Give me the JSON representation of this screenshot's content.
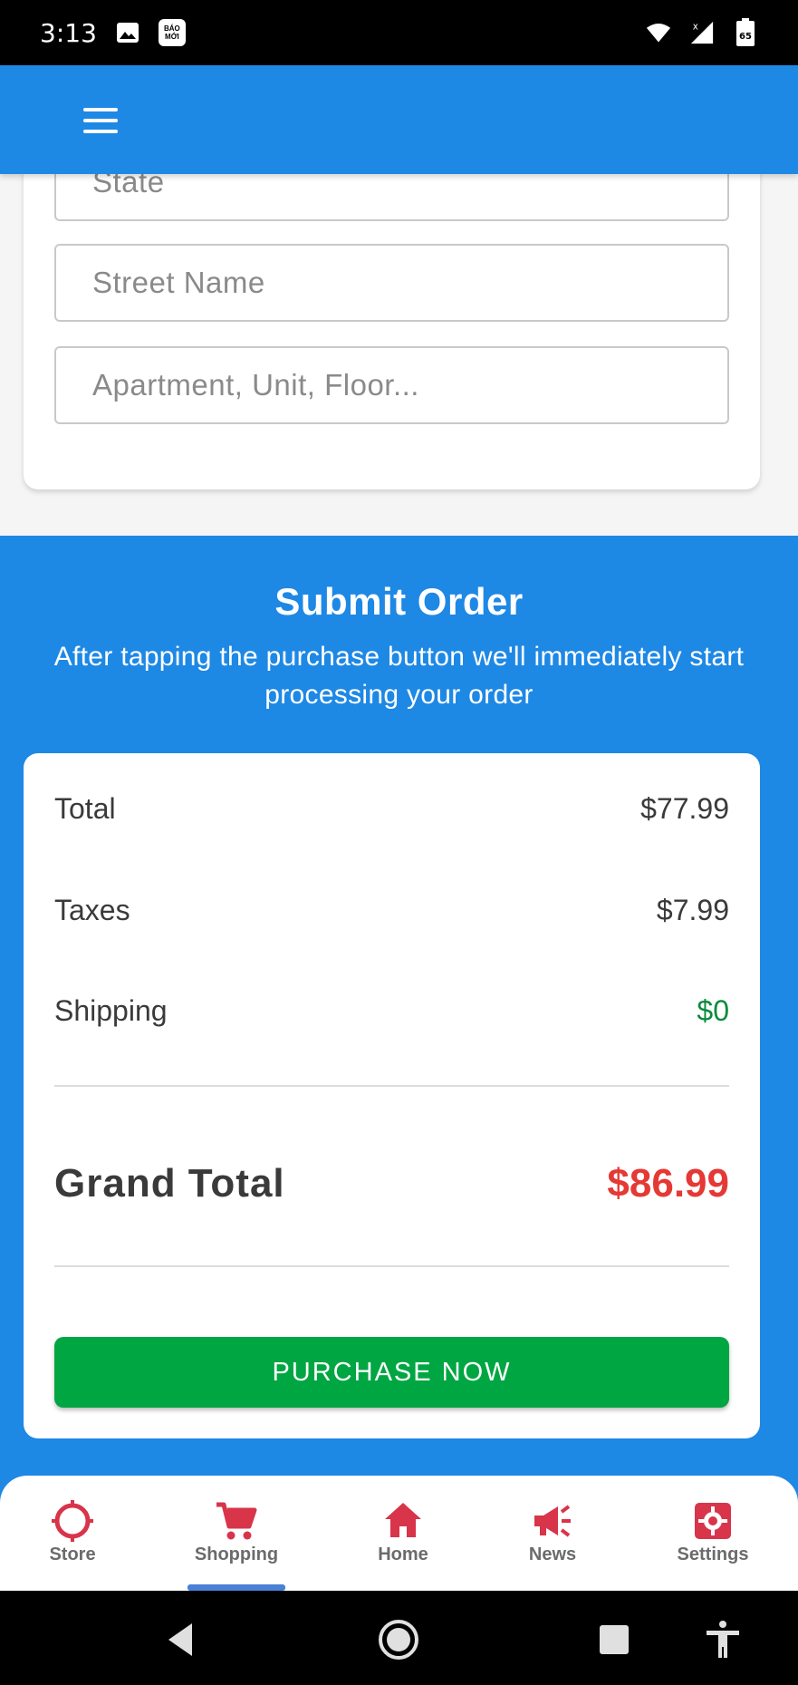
{
  "status_bar": {
    "time": "3:13",
    "notification_badge": "BÁO MỚI",
    "battery": "65"
  },
  "app_bar": {
    "menu_icon": "hamburger-menu-icon"
  },
  "address_form": {
    "state_placeholder": "State",
    "street_placeholder": "Street Name",
    "apartment_placeholder": "Apartment, Unit, Floor..."
  },
  "submit_order": {
    "title": "Submit Order",
    "description": "After tapping the purchase button we'll immediately start processing your order"
  },
  "summary": {
    "total_label": "Total",
    "total_value": "$77.99",
    "taxes_label": "Taxes",
    "taxes_value": "$7.99",
    "shipping_label": "Shipping",
    "shipping_value": "$0",
    "grand_total_label": "Grand Total",
    "grand_total_value": "$86.99",
    "purchase_button": "PURCHASE NOW"
  },
  "bottom_nav": {
    "items": [
      {
        "label": "Store",
        "icon": "crosshair-icon"
      },
      {
        "label": "Shopping",
        "icon": "cart-icon"
      },
      {
        "label": "Home",
        "icon": "home-icon"
      },
      {
        "label": "News",
        "icon": "megaphone-icon"
      },
      {
        "label": "Settings",
        "icon": "gear-icon"
      }
    ],
    "active": "Shopping"
  },
  "colors": {
    "primary": "#1e88e5",
    "accent_red": "#e53935",
    "success_green": "#00a642",
    "shipping_green": "#0b8a3c",
    "nav_icon_red": "#d8344a"
  }
}
